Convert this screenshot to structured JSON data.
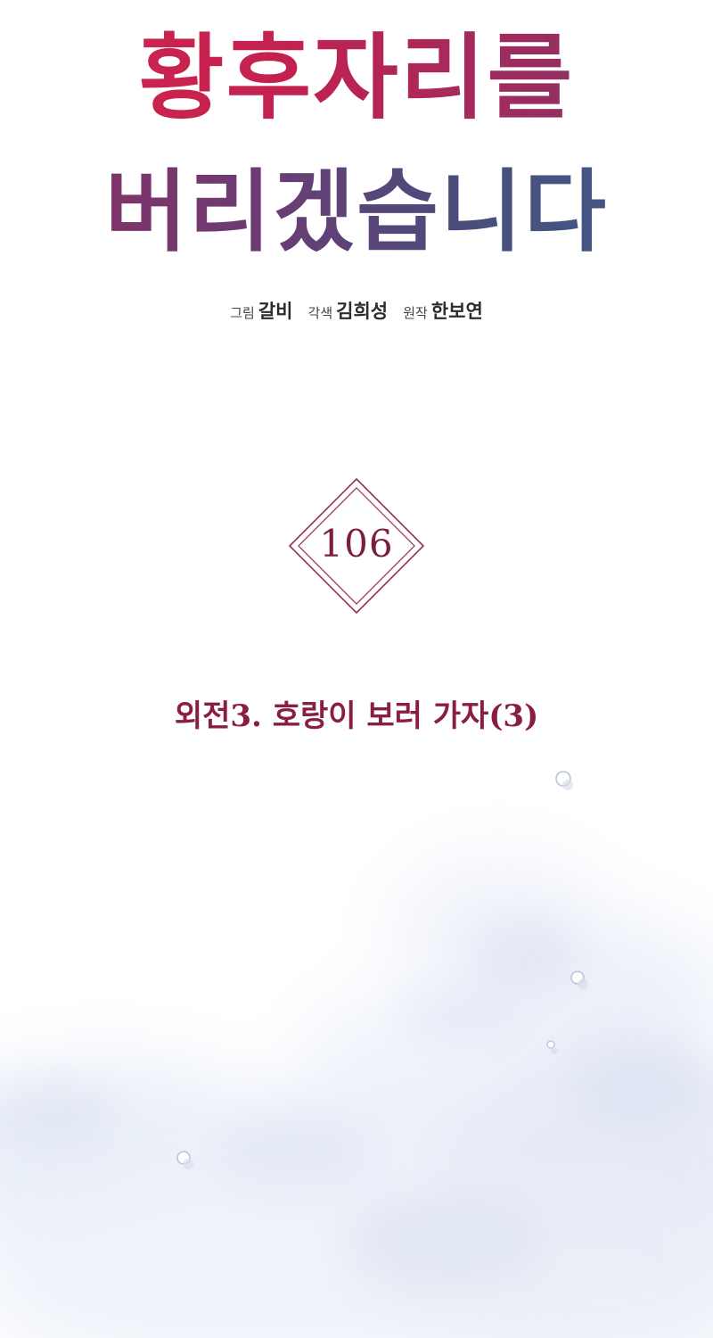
{
  "title": {
    "line1": "황후자리를",
    "line2": "버리겠습니다"
  },
  "credits": [
    {
      "role": "그림",
      "name": "갈비"
    },
    {
      "role": "각색",
      "name": "김희성"
    },
    {
      "role": "원작",
      "name": "한보연"
    }
  ],
  "episode": {
    "number": "106",
    "title": "외전3. 호랑이 보러 가자(3)"
  },
  "colors": {
    "title_start": "#d2254f",
    "title_end": "#3e5e86",
    "badge": "#9a2e52",
    "episode_title": "#8a1e3f",
    "background": "#ffffff",
    "cloud": "#e4eaf6"
  }
}
